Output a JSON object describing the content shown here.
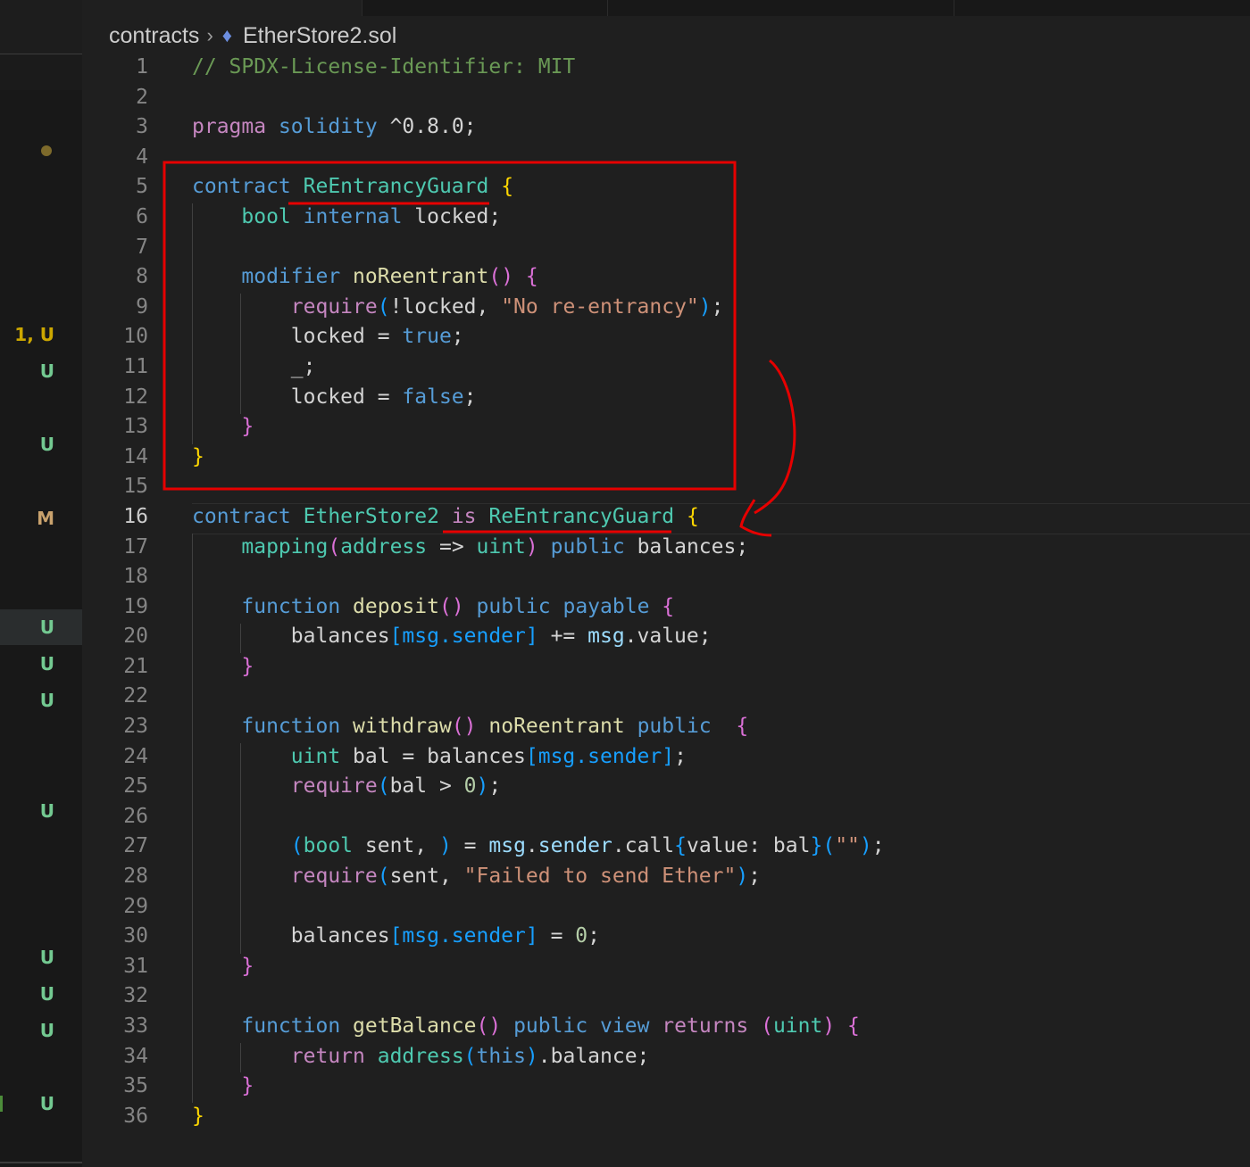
{
  "breadcrumb": {
    "folder": "contracts",
    "file": "EtherStore2.sol"
  },
  "gutter_badges": [
    "1, U",
    "U",
    "U",
    "M",
    "U",
    "U",
    "U",
    "U",
    "U",
    "U",
    "U",
    "U"
  ],
  "editor": {
    "current_line": 16,
    "lines": [
      {
        "n": "1",
        "tokens": [
          [
            "k-com",
            "// SPDX-License-Identifier: MIT"
          ]
        ]
      },
      {
        "n": "2",
        "tokens": []
      },
      {
        "n": "3",
        "tokens": [
          [
            "k-kw",
            "pragma"
          ],
          [
            "k-plain",
            " "
          ],
          [
            "k-blue",
            "solidity"
          ],
          [
            "k-plain",
            " ^0.8.0;"
          ]
        ]
      },
      {
        "n": "4",
        "tokens": []
      },
      {
        "n": "5",
        "tokens": [
          [
            "k-blue",
            "contract"
          ],
          [
            "k-plain",
            " "
          ],
          [
            "k-type",
            "ReEntrancyGuard"
          ],
          [
            "k-plain",
            " "
          ],
          [
            "k-y",
            "{"
          ]
        ]
      },
      {
        "n": "6",
        "tokens": [
          [
            "k-plain",
            "    "
          ],
          [
            "k-type",
            "bool"
          ],
          [
            "k-plain",
            " "
          ],
          [
            "k-blue",
            "internal"
          ],
          [
            "k-plain",
            " locked;"
          ]
        ]
      },
      {
        "n": "7",
        "tokens": []
      },
      {
        "n": "8",
        "tokens": [
          [
            "k-plain",
            "    "
          ],
          [
            "k-blue",
            "modifier"
          ],
          [
            "k-plain",
            " "
          ],
          [
            "k-fn",
            "noReentrant"
          ],
          [
            "k-p",
            "()"
          ],
          [
            "k-plain",
            " "
          ],
          [
            "k-p",
            "{"
          ]
        ]
      },
      {
        "n": "9",
        "tokens": [
          [
            "k-plain",
            "        "
          ],
          [
            "k-kw",
            "require"
          ],
          [
            "k-b",
            "("
          ],
          [
            "k-plain",
            "!locked, "
          ],
          [
            "k-str",
            "\"No re-entrancy\""
          ],
          [
            "k-b",
            ")"
          ],
          [
            "k-plain",
            ";"
          ]
        ]
      },
      {
        "n": "10",
        "tokens": [
          [
            "k-plain",
            "        locked = "
          ],
          [
            "k-blue",
            "true"
          ],
          [
            "k-plain",
            ";"
          ]
        ]
      },
      {
        "n": "11",
        "tokens": [
          [
            "k-plain",
            "        _;"
          ]
        ]
      },
      {
        "n": "12",
        "tokens": [
          [
            "k-plain",
            "        locked = "
          ],
          [
            "k-blue",
            "false"
          ],
          [
            "k-plain",
            ";"
          ]
        ]
      },
      {
        "n": "13",
        "tokens": [
          [
            "k-plain",
            "    "
          ],
          [
            "k-p",
            "}"
          ]
        ]
      },
      {
        "n": "14",
        "tokens": [
          [
            "k-y",
            "}"
          ]
        ]
      },
      {
        "n": "15",
        "tokens": []
      },
      {
        "n": "16",
        "tokens": [
          [
            "k-blue",
            "contract"
          ],
          [
            "k-plain",
            " "
          ],
          [
            "k-type",
            "EtherStore2"
          ],
          [
            "k-plain",
            " "
          ],
          [
            "k-kw",
            "is"
          ],
          [
            "k-plain",
            " "
          ],
          [
            "k-type",
            "ReEntrancyGuard"
          ],
          [
            "k-plain",
            " "
          ],
          [
            "k-y",
            "{"
          ]
        ]
      },
      {
        "n": "17",
        "tokens": [
          [
            "k-plain",
            "    "
          ],
          [
            "k-type",
            "mapping"
          ],
          [
            "k-p",
            "("
          ],
          [
            "k-type",
            "address"
          ],
          [
            "k-plain",
            " => "
          ],
          [
            "k-type",
            "uint"
          ],
          [
            "k-p",
            ")"
          ],
          [
            "k-plain",
            " "
          ],
          [
            "k-blue",
            "public"
          ],
          [
            "k-plain",
            " balances;"
          ]
        ]
      },
      {
        "n": "18",
        "tokens": []
      },
      {
        "n": "19",
        "tokens": [
          [
            "k-plain",
            "    "
          ],
          [
            "k-blue",
            "function"
          ],
          [
            "k-plain",
            " "
          ],
          [
            "k-fn",
            "deposit"
          ],
          [
            "k-p",
            "()"
          ],
          [
            "k-plain",
            " "
          ],
          [
            "k-blue",
            "public"
          ],
          [
            "k-plain",
            " "
          ],
          [
            "k-blue",
            "payable"
          ],
          [
            "k-plain",
            " "
          ],
          [
            "k-p",
            "{"
          ]
        ]
      },
      {
        "n": "20",
        "tokens": [
          [
            "k-plain",
            "        balances"
          ],
          [
            "k-b",
            "[msg.sender]"
          ],
          [
            "k-plain",
            " += "
          ],
          [
            "k-var",
            "msg"
          ],
          [
            "k-plain",
            ".value;"
          ]
        ]
      },
      {
        "n": "21",
        "tokens": [
          [
            "k-plain",
            "    "
          ],
          [
            "k-p",
            "}"
          ]
        ]
      },
      {
        "n": "22",
        "tokens": []
      },
      {
        "n": "23",
        "tokens": [
          [
            "k-plain",
            "    "
          ],
          [
            "k-blue",
            "function"
          ],
          [
            "k-plain",
            " "
          ],
          [
            "k-fn",
            "withdraw"
          ],
          [
            "k-p",
            "()"
          ],
          [
            "k-plain",
            " "
          ],
          [
            "k-fn",
            "noReentrant"
          ],
          [
            "k-plain",
            " "
          ],
          [
            "k-blue",
            "public"
          ],
          [
            "k-plain",
            "  "
          ],
          [
            "k-p",
            "{"
          ]
        ]
      },
      {
        "n": "24",
        "tokens": [
          [
            "k-plain",
            "        "
          ],
          [
            "k-type",
            "uint"
          ],
          [
            "k-plain",
            " bal = balances"
          ],
          [
            "k-b",
            "[msg.sender]"
          ],
          [
            "k-plain",
            ";"
          ]
        ]
      },
      {
        "n": "25",
        "tokens": [
          [
            "k-plain",
            "        "
          ],
          [
            "k-kw",
            "require"
          ],
          [
            "k-b",
            "("
          ],
          [
            "k-plain",
            "bal > "
          ],
          [
            "k-num",
            "0"
          ],
          [
            "k-b",
            ")"
          ],
          [
            "k-plain",
            ";"
          ]
        ]
      },
      {
        "n": "26",
        "tokens": []
      },
      {
        "n": "27",
        "tokens": [
          [
            "k-plain",
            "        "
          ],
          [
            "k-b",
            "("
          ],
          [
            "k-type",
            "bool"
          ],
          [
            "k-plain",
            " sent, "
          ],
          [
            "k-b",
            ")"
          ],
          [
            "k-plain",
            " = "
          ],
          [
            "k-var",
            "msg"
          ],
          [
            "k-plain",
            "."
          ],
          [
            "k-var",
            "sender"
          ],
          [
            "k-plain",
            ".call"
          ],
          [
            "k-b",
            "{"
          ],
          [
            "k-plain",
            "value: bal"
          ],
          [
            "k-b",
            "}"
          ],
          [
            "k-b",
            "("
          ],
          [
            "k-str",
            "\"\""
          ],
          [
            "k-b",
            ")"
          ],
          [
            "k-plain",
            ";"
          ]
        ]
      },
      {
        "n": "28",
        "tokens": [
          [
            "k-plain",
            "        "
          ],
          [
            "k-kw",
            "require"
          ],
          [
            "k-b",
            "("
          ],
          [
            "k-plain",
            "sent, "
          ],
          [
            "k-str",
            "\"Failed to send Ether\""
          ],
          [
            "k-b",
            ")"
          ],
          [
            "k-plain",
            ";"
          ]
        ]
      },
      {
        "n": "29",
        "tokens": []
      },
      {
        "n": "30",
        "tokens": [
          [
            "k-plain",
            "        balances"
          ],
          [
            "k-b",
            "[msg.sender]"
          ],
          [
            "k-plain",
            " = "
          ],
          [
            "k-num",
            "0"
          ],
          [
            "k-plain",
            ";"
          ]
        ]
      },
      {
        "n": "31",
        "tokens": [
          [
            "k-plain",
            "    "
          ],
          [
            "k-p",
            "}"
          ]
        ]
      },
      {
        "n": "32",
        "tokens": []
      },
      {
        "n": "33",
        "tokens": [
          [
            "k-plain",
            "    "
          ],
          [
            "k-blue",
            "function"
          ],
          [
            "k-plain",
            " "
          ],
          [
            "k-fn",
            "getBalance"
          ],
          [
            "k-p",
            "()"
          ],
          [
            "k-plain",
            " "
          ],
          [
            "k-blue",
            "public"
          ],
          [
            "k-plain",
            " "
          ],
          [
            "k-blue",
            "view"
          ],
          [
            "k-plain",
            " "
          ],
          [
            "k-kw",
            "returns"
          ],
          [
            "k-plain",
            " "
          ],
          [
            "k-p",
            "("
          ],
          [
            "k-type",
            "uint"
          ],
          [
            "k-p",
            ")"
          ],
          [
            "k-plain",
            " "
          ],
          [
            "k-p",
            "{"
          ]
        ]
      },
      {
        "n": "34",
        "tokens": [
          [
            "k-plain",
            "        "
          ],
          [
            "k-kw",
            "return"
          ],
          [
            "k-plain",
            " "
          ],
          [
            "k-type",
            "address"
          ],
          [
            "k-b",
            "("
          ],
          [
            "k-blue",
            "this"
          ],
          [
            "k-b",
            ")"
          ],
          [
            "k-plain",
            ".balance;"
          ]
        ]
      },
      {
        "n": "35",
        "tokens": [
          [
            "k-plain",
            "    "
          ],
          [
            "k-p",
            "}"
          ]
        ]
      },
      {
        "n": "36",
        "tokens": [
          [
            "k-y",
            "}"
          ]
        ]
      }
    ]
  },
  "colors": {
    "annotation": "#e60000",
    "background": "#1f1f1f"
  }
}
